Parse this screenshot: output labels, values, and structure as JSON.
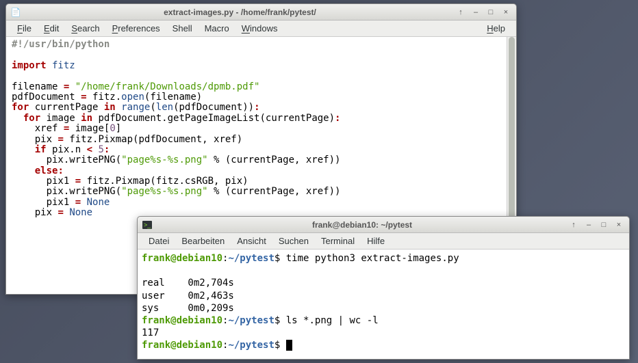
{
  "editor": {
    "title": "extract-images.py - /home/frank/pytest/",
    "menu": {
      "file": "File",
      "edit": "Edit",
      "search": "Search",
      "preferences": "Preferences",
      "shell": "Shell",
      "macro": "Macro",
      "windows": "Windows",
      "help": "Help"
    },
    "code": {
      "line1": "#!/usr/bin/python",
      "l3_import": "import",
      "l3_mod": " fitz",
      "l5a": "filename ",
      "op_eq": "=",
      "l5_str": " \"/home/frank/Downloads/dpmb.pdf\"",
      "l6a": "pdfDocument ",
      "l6b": " fitz.",
      "open": "open",
      "l6c": "(filename)",
      "for": "for",
      "l7a": " currentPage ",
      "in": "in",
      "l7b": " ",
      "range": "range",
      "l7c": "(",
      "len": "len",
      "l7d": "(pdfDocument))",
      "colon": ":",
      "l8a": " image ",
      "l8b": " pdfDocument.getPageImageList(currentPage)",
      "l9a": "    xref ",
      "l9b": " image[",
      "zero": "0",
      "l9c": "]",
      "l10a": "    pix ",
      "l10b": " fitz.Pixmap(pdfDocument, xref)",
      "if": "if",
      "l11a": " pix.n ",
      "lt": "<",
      "l11b": " ",
      "five": "5",
      "l12a": "      pix.writePNG(",
      "png_fmt": "\"page%s-%s.png\"",
      "l12b": " % (currentPage, xref))",
      "else": "else",
      "l14a": "      pix1 ",
      "l14b": " fitz.Pixmap(fitz.csRGB, pix)",
      "l15a": "      pix.writePNG(",
      "l16a": "      pix1 ",
      "none": "None",
      "l17a": "    pix ",
      "sp1": " "
    }
  },
  "terminal": {
    "title": "frank@debian10: ~/pytest",
    "menu": {
      "datei": "Datei",
      "bearbeiten": "Bearbeiten",
      "ansicht": "Ansicht",
      "suchen": "Suchen",
      "terminal": "Terminal",
      "hilfe": "Hilfe"
    },
    "prompt_user": "frank@debian10",
    "prompt_sep": ":",
    "prompt_path": "~/pytest",
    "prompt_end": "$",
    "cmd1": " time python3 extract-images.py",
    "out_real": "real    0m2,704s",
    "out_user": "user    0m2,463s",
    "out_sys": "sys     0m0,209s",
    "cmd2": " ls *.png | wc -l",
    "out_count": "117"
  },
  "titlebar_buttons": {
    "up": "↑",
    "minimize": "–",
    "maximize": "□",
    "close": "×"
  }
}
